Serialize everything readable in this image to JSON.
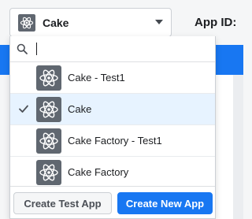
{
  "page": {
    "app_id_label": "App ID:"
  },
  "selector": {
    "current_app": "Cake",
    "app_icon": "atom-icon",
    "caret_icon": "caret-down-icon"
  },
  "dropdown": {
    "search": {
      "value": "",
      "placeholder": "",
      "icon": "search-icon"
    },
    "apps": [
      {
        "label": "Cake - Test1",
        "selected": false,
        "icon": "atom-icon"
      },
      {
        "label": "Cake",
        "selected": true,
        "icon": "atom-icon"
      },
      {
        "label": "Cake Factory - Test1",
        "selected": false,
        "icon": "atom-icon"
      },
      {
        "label": "Cake Factory",
        "selected": false,
        "icon": "atom-icon"
      }
    ],
    "buttons": {
      "create_test_app": "Create Test App",
      "create_new_app": "Create New App"
    }
  },
  "colors": {
    "accent": "#1877f2",
    "selected_row": "#e7f3ff",
    "icon_bg": "#606770"
  }
}
